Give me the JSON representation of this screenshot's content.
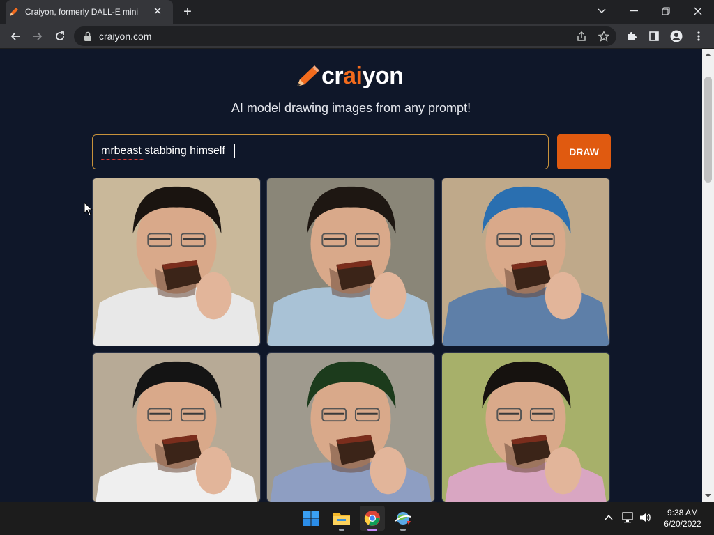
{
  "browser": {
    "tab_title": "Craiyon, formerly DALL-E mini",
    "url": "craiyon.com",
    "accent": "#f26b1d"
  },
  "page": {
    "logo": {
      "prefix": "cr",
      "highlight": "ai",
      "suffix": "yon"
    },
    "tagline": "AI model drawing images from any prompt!",
    "prompt_value": "mrbeast stabbing himself",
    "draw_label": "DRAW",
    "results": [
      {
        "label": "image 1",
        "bg": "#c9b89a",
        "shirt": "#e8e8e8",
        "hair": "#1a1410"
      },
      {
        "label": "image 2",
        "bg": "#8a8678",
        "shirt": "#a9c2d6",
        "hair": "#1e1712"
      },
      {
        "label": "image 3",
        "bg": "#bfa98a",
        "shirt": "#5e7fa8",
        "hair": "#2a6fb0"
      },
      {
        "label": "image 4",
        "bg": "#b7aa96",
        "shirt": "#efefef",
        "hair": "#141414"
      },
      {
        "label": "image 5",
        "bg": "#9f9a8e",
        "shirt": "#8e9ec2",
        "hair": "#1c3b1c"
      },
      {
        "label": "image 6",
        "bg": "#a7b06a",
        "shirt": "#d9a6c2",
        "hair": "#16120f"
      }
    ]
  },
  "taskbar": {
    "apps": [
      "start-icon",
      "file-explorer-icon",
      "chrome-icon",
      "network-app-icon"
    ],
    "time": "9:38 AM",
    "date": "6/20/2022"
  }
}
